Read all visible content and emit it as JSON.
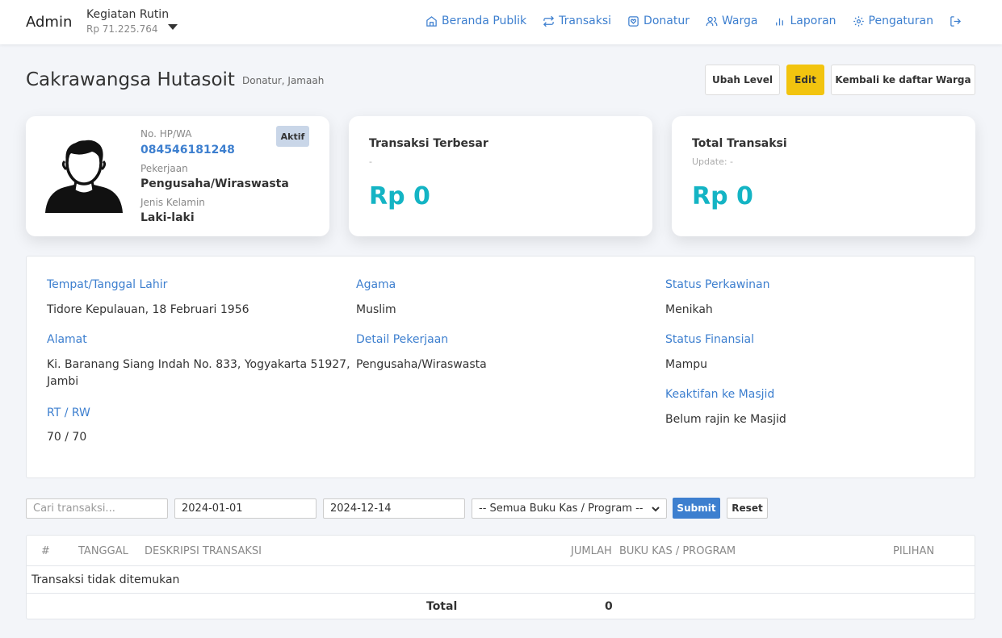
{
  "navbar": {
    "brand": "Admin",
    "account_name": "Kegiatan Rutin",
    "account_balance": "Rp 71.225.764",
    "links": {
      "home": "Beranda Publik",
      "transactions": "Transaksi",
      "donors": "Donatur",
      "residents": "Warga",
      "reports": "Laporan",
      "settings": "Pengaturan"
    }
  },
  "header": {
    "title": "Cakrawangsa Hutasoit",
    "subtitle": "Donatur, Jamaah",
    "btn_level": "Ubah Level",
    "btn_edit": "Edit",
    "btn_back": "Kembali ke daftar Warga"
  },
  "profile": {
    "status_badge": "Aktif",
    "phone_label": "No. HP/WA",
    "phone": "084546181248",
    "job_label": "Pekerjaan",
    "job": "Pengusaha/Wiraswasta",
    "gender_label": "Jenis Kelamin",
    "gender": "Laki-laki"
  },
  "largest_transaction": {
    "title": "Transaksi Terbesar",
    "sub": "-",
    "value": "Rp 0"
  },
  "total_transaction": {
    "title": "Total Transaksi",
    "sub": "Update: -",
    "value": "Rp 0"
  },
  "details": {
    "birth_label": "Tempat/Tanggal Lahir",
    "birth": "Tidore Kepulauan, 18 Februari 1956",
    "address_label": "Alamat",
    "address_line1": "Ki. Baranang Siang Indah No. 833, Yogyakarta 51927,",
    "address_line2": "Jambi",
    "rtrw_label": "RT / RW",
    "rtrw": "70 / 70",
    "religion_label": "Agama",
    "religion": "Muslim",
    "job_detail_label": "Detail Pekerjaan",
    "job_detail": "Pengusaha/Wiraswasta",
    "marital_label": "Status Perkawinan",
    "marital": "Menikah",
    "financial_label": "Status Finansial",
    "financial": "Mampu",
    "mosque_label": "Keaktifan ke Masjid",
    "mosque": "Belum rajin ke Masjid"
  },
  "filters": {
    "search_placeholder": "Cari transaksi...",
    "date_from": "2024-01-01",
    "date_to": "2024-12-14",
    "program_selected": "-- Semua Buku Kas / Program --",
    "submit": "Submit",
    "reset": "Reset"
  },
  "table": {
    "columns": [
      "#",
      "Tanggal",
      "Deskripsi Transaksi",
      "Jumlah",
      "Buku Kas / Program",
      "Pilihan"
    ],
    "empty_message": "Transaksi tidak ditemukan",
    "total_label": "Total",
    "total_value": "0"
  }
}
